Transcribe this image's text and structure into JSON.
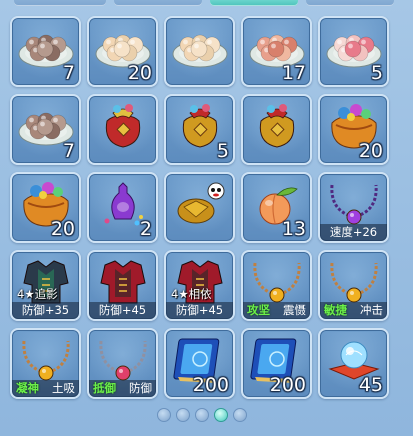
{
  "top_tabs": [
    {
      "active": false
    },
    {
      "active": false
    },
    {
      "active": true
    },
    {
      "active": false
    }
  ],
  "items": [
    {
      "icon": "rice-ball-plate-icon",
      "count": "7"
    },
    {
      "icon": "egg-dumpling-plate-icon",
      "count": "20"
    },
    {
      "icon": "egg-dumpling-plate-icon",
      "count": ""
    },
    {
      "icon": "red-dumpling-plate-icon",
      "count": "17"
    },
    {
      "icon": "pink-dumpling-plate-icon",
      "count": "5"
    },
    {
      "icon": "rice-ball-plate-icon",
      "count": "7"
    },
    {
      "icon": "red-lucky-bag-icon",
      "count": ""
    },
    {
      "icon": "gold-lucky-bag-icon",
      "count": "5"
    },
    {
      "icon": "gold-lucky-bag-icon",
      "count": ""
    },
    {
      "icon": "treasure-sack-icon",
      "count": "20"
    },
    {
      "icon": "treasure-sack-icon",
      "count": "20"
    },
    {
      "icon": "purple-vase-icon",
      "count": "2"
    },
    {
      "icon": "golden-turtle-pet-icon",
      "count": ""
    },
    {
      "icon": "peach-icon",
      "count": "13"
    },
    {
      "icon": "purple-necklace-icon",
      "count": "",
      "stat": "速度+26"
    },
    {
      "icon": "dark-armor-icon",
      "count": "",
      "star": "4★追影",
      "stat": "防御+35"
    },
    {
      "icon": "red-armor-icon",
      "count": "",
      "stat": "防御+45"
    },
    {
      "icon": "red-armor-icon",
      "count": "",
      "star": "4★相依",
      "stat": "防御+45"
    },
    {
      "icon": "gold-pendant-necklace-icon",
      "count": "",
      "split": {
        "left": "攻坚",
        "right": "震慑"
      }
    },
    {
      "icon": "gold-pendant-necklace-icon",
      "count": "",
      "split": {
        "left": "敏捷",
        "right": "冲击"
      }
    },
    {
      "icon": "gold-pendant-necklace-icon",
      "count": "",
      "split": {
        "left": "凝神",
        "right": "土吸"
      }
    },
    {
      "icon": "silver-necklace-icon",
      "count": "",
      "split": {
        "left": "抵御",
        "right": "防御"
      }
    },
    {
      "icon": "blue-book-icon",
      "count": "200"
    },
    {
      "icon": "blue-book-icon",
      "count": "200"
    },
    {
      "icon": "crystal-orb-cushion-icon",
      "count": "45"
    }
  ],
  "pager": {
    "pages": 5,
    "active_index": 3
  },
  "colors": {
    "background": "#9bbfe2",
    "slot": "#5d8cbe",
    "slot_border": "#cfe3f5",
    "active_tab": "#4cc2bb",
    "stat_highlight": "#6cf04a"
  }
}
